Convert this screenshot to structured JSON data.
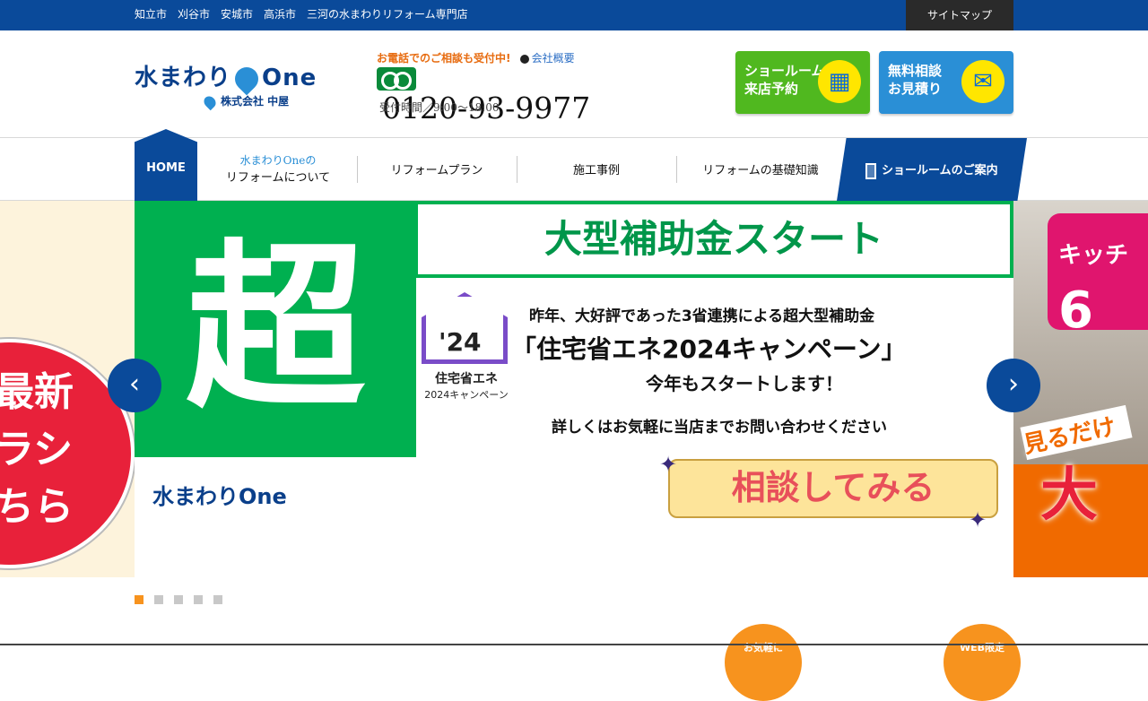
{
  "topbar": {
    "areas_text": "知立市　刈谷市　安城市　高浜市　三河の水まわりリフォーム専門店",
    "sitemap_label": "サイトマップ"
  },
  "header": {
    "logo_main_left": "水まわり",
    "logo_main_right": "One",
    "logo_sub": "株式会社 中屋",
    "phone_lead": "お電話でのご相談も受付中!",
    "company_link": "会社概要",
    "phone_number": "0120-93-9977",
    "phone_hours": "受付時間／9:00〜18:00",
    "cta_showroom_line1": "ショールーム",
    "cta_showroom_line2": "来店予約",
    "cta_consult_line1": "無料相談",
    "cta_consult_line2": "お見積り"
  },
  "nav": {
    "home": "HOME",
    "about_sub": "水まわりOneの",
    "about": "リフォームについて",
    "plan": "リフォームプラン",
    "cases": "施工事例",
    "basics": "リフォームの基礎知識",
    "showroom": "ショールームのご案内"
  },
  "slider": {
    "left_peek_line1": "最新",
    "left_peek_line2": "ラシ",
    "left_peek_line3": "ちら",
    "big_char": "超",
    "banner": "大型補助金スタート",
    "badge_year": "'24",
    "badge_label": "住宅省エネ",
    "badge_sub": "2024キャンペーン",
    "text1": "昨年、大好評であった3省連携による超大型補助金",
    "text2": "「住宅省エネ2024キャンペーン」",
    "text3": "今年もスタートします！",
    "text4": "詳しくはお気軽に当店までお問い合わせください",
    "consult_button": "相談してみる",
    "bottom_logo": "水まわりOne",
    "right_peek_tag1": "キッチ",
    "right_peek_tag2": "6",
    "right_peek_red": "大",
    "right_peek_text": "見るだけ",
    "prev_arrow": "‹",
    "next_arrow": "›",
    "active_dot": 1,
    "dot_count": 5
  },
  "bottom": {
    "peek_left": "お気軽に",
    "peek_right": "WEB限定"
  },
  "colors": {
    "brand_blue": "#0a4a9a",
    "accent_orange": "#f7931e",
    "green": "#00b050",
    "showroom_green": "#50b81f",
    "consult_blue": "#2a8fd6"
  }
}
